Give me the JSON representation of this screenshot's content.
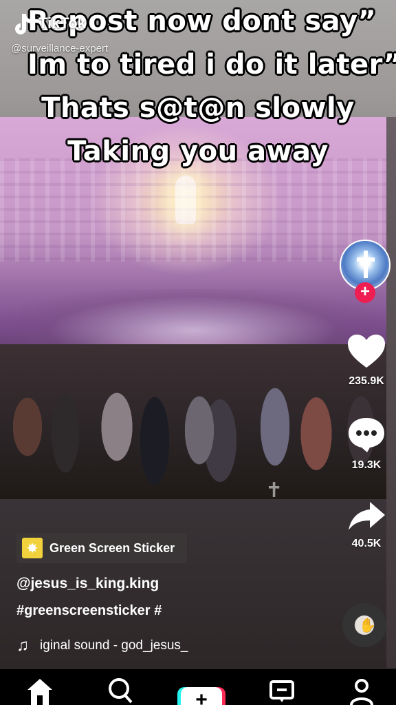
{
  "watermark": {
    "brand": "TikTok",
    "handle": "@surveillance-expert"
  },
  "caption_lines": [
    "Repost now dont say”",
    "Im to tired i do it later”",
    "Thats s@t@n slowly",
    "Taking you away"
  ],
  "actions": {
    "likes": "235.9K",
    "comments": "19.3K",
    "shares": "40.5K"
  },
  "sticker": {
    "label": "Green Screen Sticker"
  },
  "post": {
    "username": "@jesus_is_king.king",
    "hashtags": "#greenscreensticker #",
    "sound": "iginal sound - god_jesus_"
  },
  "nav": [
    "home-icon",
    "discover-icon",
    "create-icon",
    "inbox-icon",
    "profile-icon"
  ],
  "colors": {
    "follow": "#ee1d52",
    "create_cyan": "#25f4ee",
    "create_red": "#fe2c55"
  }
}
